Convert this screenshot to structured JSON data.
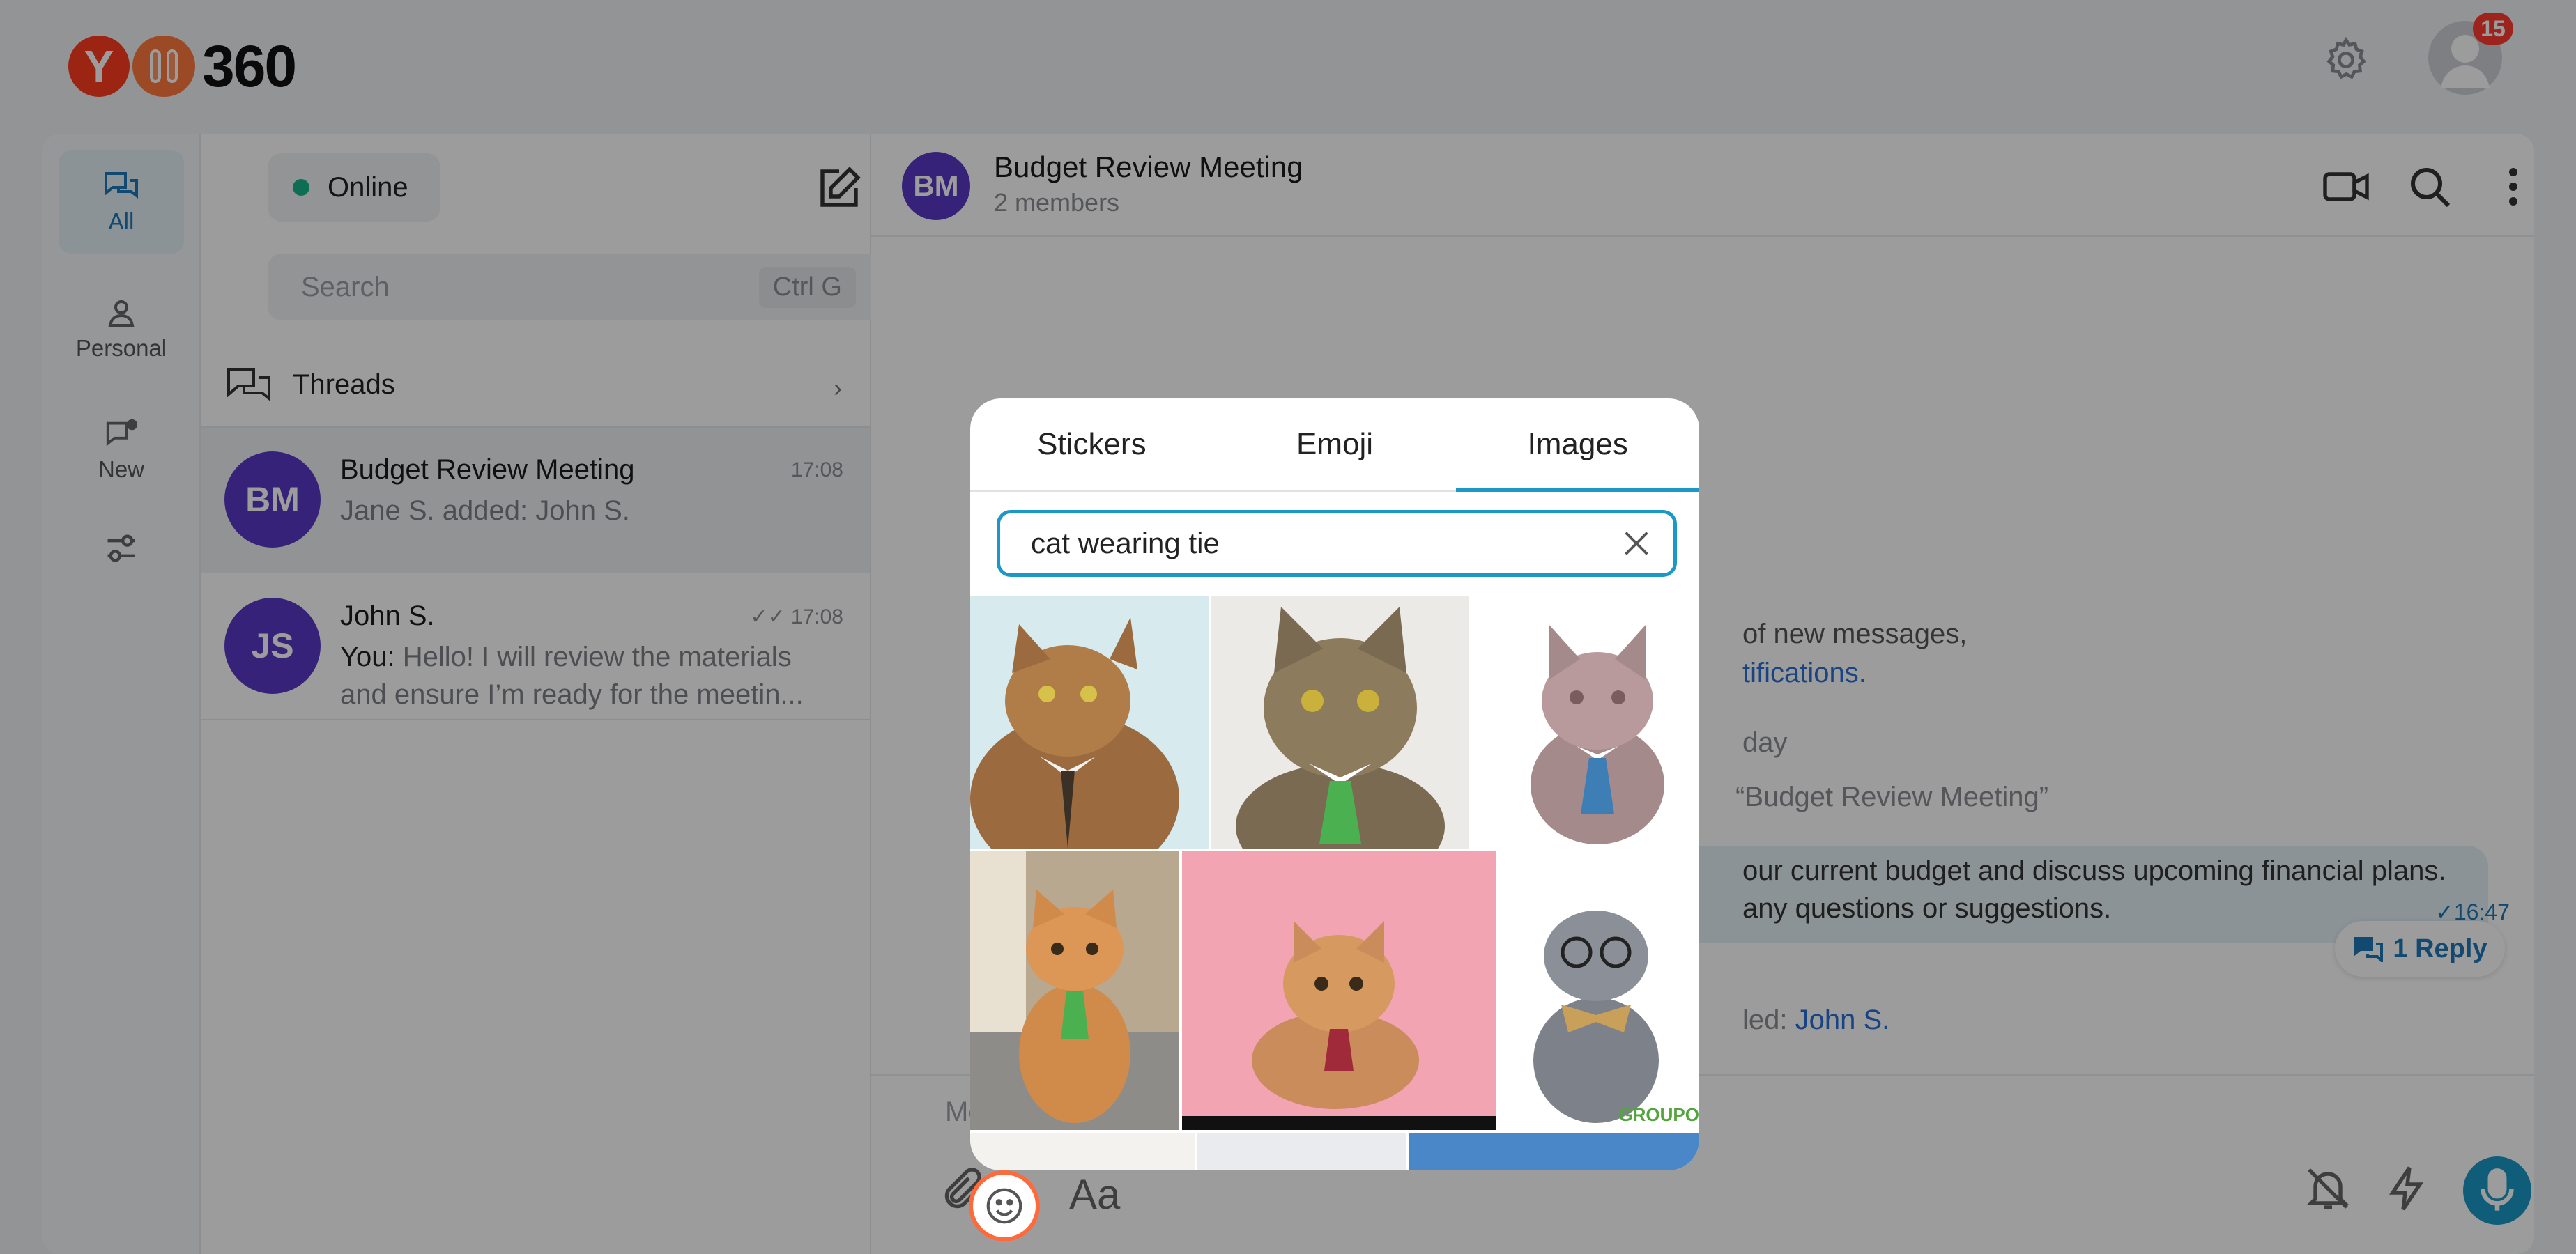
{
  "header": {
    "logo_text": "360",
    "logo_letter": "Y",
    "notifications_count": "15"
  },
  "rail": {
    "items": [
      {
        "label": "All",
        "icon": "chats-icon",
        "active": true
      },
      {
        "label": "Personal",
        "icon": "person-icon"
      },
      {
        "label": "New",
        "icon": "new-chat-icon"
      },
      {
        "label": "",
        "icon": "filters-icon"
      }
    ]
  },
  "list": {
    "status": "Online",
    "search_placeholder": "Search",
    "search_shortcut": "Ctrl G",
    "threads_label": "Threads",
    "chats": [
      {
        "initials": "BM",
        "name": "Budget Review Meeting",
        "time": "17:08",
        "preview": "Jane S. added: John S."
      },
      {
        "initials": "JS",
        "name": "John S.",
        "time": "17:08",
        "preview_prefix": "You:",
        "preview": " Hello! I will review the materials and ensure I’m ready for the meetin..."
      }
    ]
  },
  "conversation": {
    "initials": "BM",
    "title": "Budget Review Meeting",
    "subtitle": "2 members",
    "line1": "of new messages,",
    "line2_link": "tifications.",
    "line3": "day",
    "line4": "“Budget Review Meeting”",
    "bubble_line1": "our current budget and discuss upcoming financial plans.",
    "bubble_line2": "any questions or suggestions.",
    "bubble_time": "16:47",
    "reply_label": "1 Reply",
    "added_prefix": "led:",
    "added_name": "John S.",
    "message_placeholder": "Mess",
    "format_label": "Aa"
  },
  "picker": {
    "tabs": [
      "Stickers",
      "Emoji",
      "Images"
    ],
    "active_tab": "Images",
    "search_value": "cat wearing tie",
    "images": [
      {
        "name": "cat-looking-up-tie"
      },
      {
        "name": "tabby-cat-green-tie"
      },
      {
        "name": "cat-sticker-blue-tie"
      },
      {
        "name": "orange-cat-green-tie"
      },
      {
        "name": "cat-pink-background-red-tie"
      },
      {
        "name": "grey-cat-bowtie-glasses",
        "watermark": "GROUPO"
      }
    ]
  },
  "colors": {
    "accent": "#1b98c7",
    "brand": "#ff3b1f",
    "avatar": "#5a39c7",
    "online": "#18b489"
  }
}
